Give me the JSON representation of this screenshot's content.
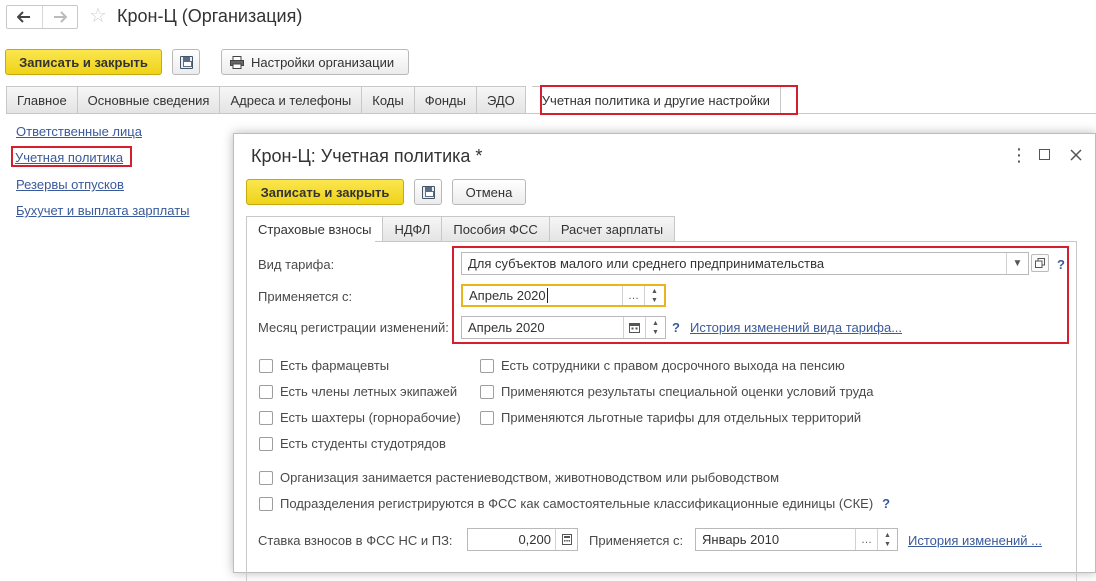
{
  "window": {
    "title": "Крон-Ц (Организация)"
  },
  "toolbar": {
    "save_close_label": "Записать и закрыть",
    "org_settings_label": "Настройки организации"
  },
  "tabs": [
    {
      "label": "Главное"
    },
    {
      "label": "Основные сведения"
    },
    {
      "label": "Адреса и телефоны"
    },
    {
      "label": "Коды"
    },
    {
      "label": "Фонды"
    },
    {
      "label": "ЭДО"
    },
    {
      "label": "Учетная политика и другие настройки",
      "active": true
    }
  ],
  "sidebar": {
    "links": [
      {
        "label": "Ответственные лица"
      },
      {
        "label": "Учетная политика"
      },
      {
        "label": "Резервы отпусков"
      },
      {
        "label": "Бухучет и выплата зарплаты"
      }
    ]
  },
  "dialog": {
    "title": "Крон-Ц: Учетная политика *",
    "save_close_label": "Записать и закрыть",
    "cancel_label": "Отмена",
    "tabs": [
      {
        "label": "Страховые взносы",
        "active": true
      },
      {
        "label": "НДФЛ"
      },
      {
        "label": "Пособия ФСС"
      },
      {
        "label": "Расчет зарплаты"
      }
    ],
    "tariff_type": {
      "label": "Вид тарифа:",
      "value": "Для субъектов малого или среднего предпринимательства"
    },
    "applies_from": {
      "label": "Применяется с:",
      "value": "Апрель 2020"
    },
    "change_month": {
      "label": "Месяц регистрации изменений:",
      "value": "Апрель 2020"
    },
    "help_mark": "?",
    "tariff_history_link": "История изменений вида тарифа...",
    "checkboxes_left": [
      "Есть фармацевты",
      "Есть члены летных экипажей",
      "Есть шахтеры (горнорабочие)",
      "Есть студенты студотрядов"
    ],
    "checkboxes_right": [
      "Есть сотрудники с правом досрочного выхода на пенсию",
      "Применяются результаты специальной оценки условий труда",
      "Применяются льготные тарифы для отдельных территорий"
    ],
    "checkbox_agri": "Организация занимается растениеводством, животноводством или рыбоводством",
    "checkbox_ske": "Подразделения регистрируются в ФСС как самостоятельные классификационные единицы (СКЕ)",
    "rate": {
      "label": "Ставка взносов в ФСС НС и ПЗ:",
      "value": "0,200",
      "applies_label": "Применяется с:",
      "applies_value": "Январь 2010",
      "history_link": "История изменений ..."
    }
  },
  "colors": {
    "primary_button": "#f0d727",
    "highlight_frame": "#d4202e",
    "link": "#3a5a9b",
    "focus_border": "#e8b61c"
  }
}
